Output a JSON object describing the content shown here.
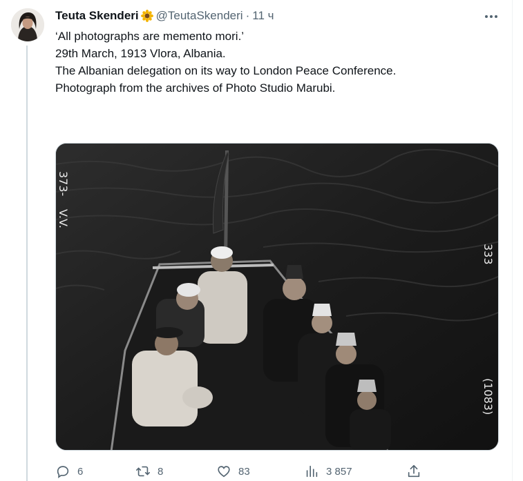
{
  "tweet": {
    "author_name": "Teuta Skenderi",
    "author_emoji": "sunflower-icon",
    "handle": "@TeutaSkenderi",
    "separator": "·",
    "time": "11 ч",
    "text_lines": [
      "‘All photographs are memento mori.’",
      "",
      "29th March, 1913 Vlora, Albania.",
      "The Albanian delegation on its way to London Peace Conference.",
      "",
      "Photograph from the archives of Photo Studio Marubi."
    ]
  },
  "metrics": {
    "replies": "6",
    "reposts": "8",
    "likes": "83",
    "views": "3 857"
  },
  "colors": {
    "text": "#0f1419",
    "secondary": "#536471",
    "thread_line": "#cfd9de"
  }
}
